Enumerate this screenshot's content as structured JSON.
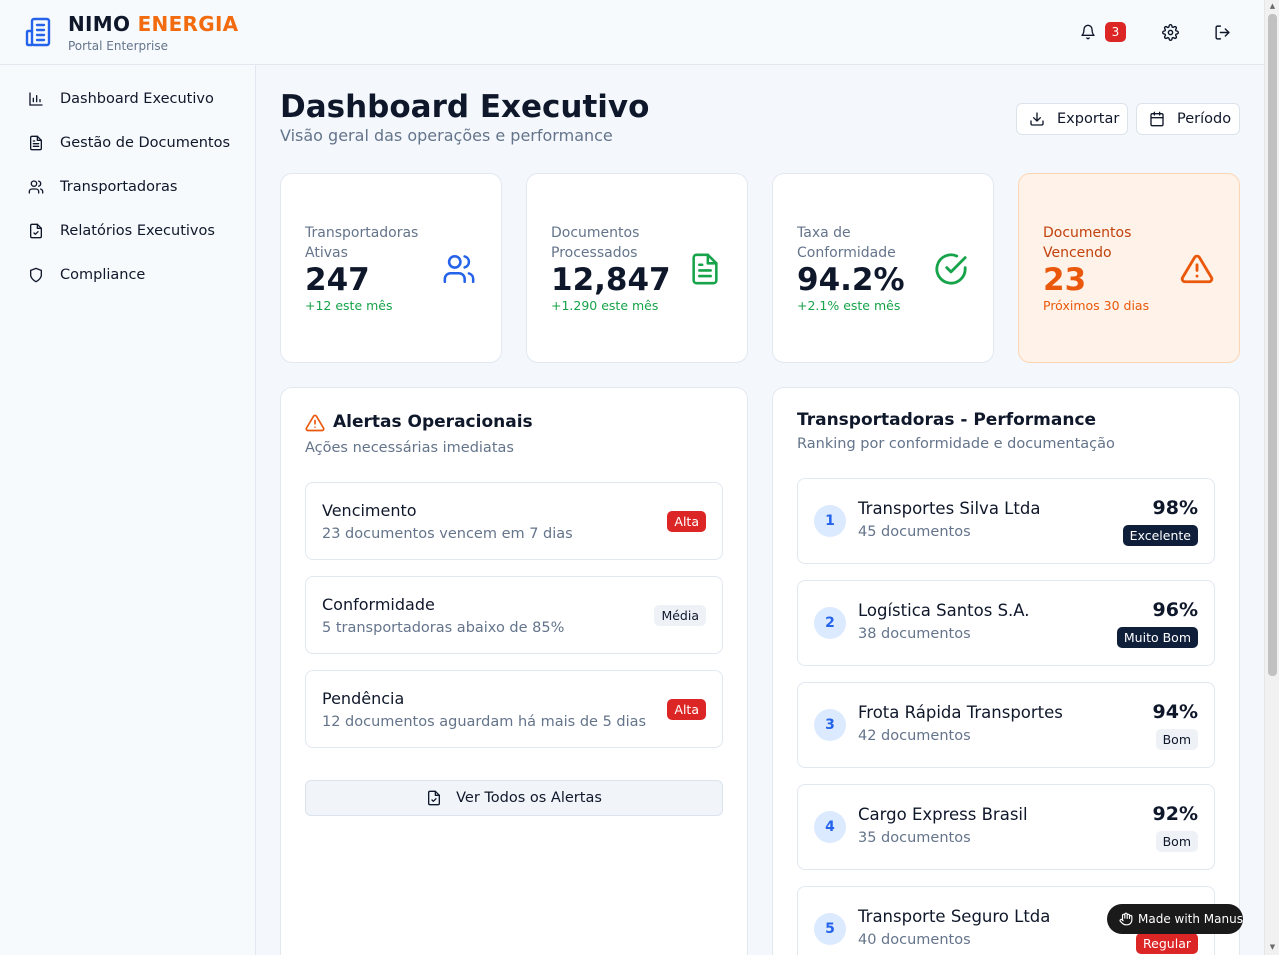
{
  "brand": {
    "name": "NIMO",
    "accent": "ENERGIA",
    "subtitle": "Portal Enterprise",
    "accent_color": "#f26b0f"
  },
  "topbar": {
    "notifications_count": "3"
  },
  "sidebar": {
    "items": [
      {
        "label": "Dashboard Executivo",
        "icon": "bar-chart-icon"
      },
      {
        "label": "Gestão de Documentos",
        "icon": "document-icon"
      },
      {
        "label": "Transportadoras",
        "icon": "users-icon"
      },
      {
        "label": "Relatórios Executivos",
        "icon": "file-check-icon"
      },
      {
        "label": "Compliance",
        "icon": "shield-icon"
      }
    ]
  },
  "header": {
    "title": "Dashboard Executivo",
    "subtitle": "Visão geral das operações e performance",
    "export_label": "Exportar",
    "period_label": "Período"
  },
  "stats": [
    {
      "label": "Transportadoras Ativas",
      "value": "247",
      "change": "+12 este mês",
      "icon": "users-icon"
    },
    {
      "label": "Documentos Processados",
      "value": "12,847",
      "change": "+1.290 este mês",
      "icon": "document-icon"
    },
    {
      "label": "Taxa de Conformidade",
      "value": "94.2%",
      "change": "+2.1% este mês",
      "icon": "check-circle-icon"
    },
    {
      "label": "Documentos Vencendo",
      "value": "23",
      "change": "Próximos 30 dias",
      "icon": "warning-icon"
    }
  ],
  "alerts": {
    "title": "Alertas Operacionais",
    "subtitle": "Ações necessárias imediatas",
    "items": [
      {
        "title": "Vencimento",
        "desc": "23 documentos vencem em 7 dias",
        "priority": "Alta"
      },
      {
        "title": "Conformidade",
        "desc": "5 transportadoras abaixo de 85%",
        "priority": "Média"
      },
      {
        "title": "Pendência",
        "desc": "12 documentos aguardam há mais de 5 dias",
        "priority": "Alta"
      }
    ],
    "view_all_label": "Ver Todos os Alertas"
  },
  "performance": {
    "title": "Transportadoras - Performance",
    "subtitle": "Ranking por conformidade e documentação",
    "items": [
      {
        "rank": "1",
        "name": "Transportes Silva Ltda",
        "docs": "45 documentos",
        "pct": "98%",
        "rating": "Excelente"
      },
      {
        "rank": "2",
        "name": "Logística Santos S.A.",
        "docs": "38 documentos",
        "pct": "96%",
        "rating": "Muito Bom"
      },
      {
        "rank": "3",
        "name": "Frota Rápida Transportes",
        "docs": "42 documentos",
        "pct": "94%",
        "rating": "Bom"
      },
      {
        "rank": "4",
        "name": "Cargo Express Brasil",
        "docs": "35 documentos",
        "pct": "92%",
        "rating": "Bom"
      },
      {
        "rank": "5",
        "name": "Transporte Seguro Ltda",
        "docs": "40 documentos",
        "pct": "",
        "rating": "Regular"
      }
    ]
  },
  "made_with": "Made with Manus"
}
